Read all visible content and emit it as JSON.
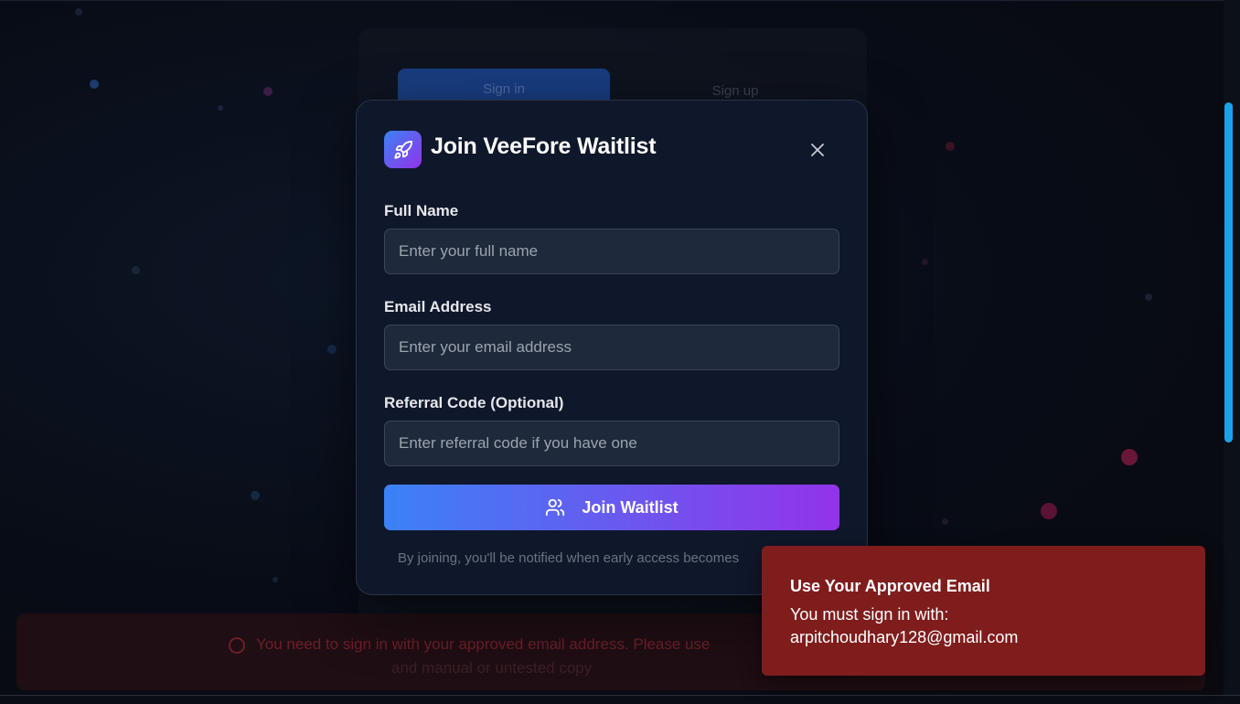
{
  "background": {
    "tab_signin": "Sign in",
    "tab_signup": "Sign up",
    "banner_line1": "You need to sign in with your approved email address. Please use",
    "banner_line2": "and manual or untested copy"
  },
  "modal": {
    "title": "Join VeeFore Waitlist",
    "logo_icon": "rocket-icon",
    "close_icon": "close-icon",
    "fields": {
      "full_name": {
        "label": "Full Name",
        "placeholder": "Enter your full name",
        "value": ""
      },
      "email": {
        "label": "Email Address",
        "placeholder": "Enter your email address",
        "value": ""
      },
      "referral": {
        "label": "Referral Code (Optional)",
        "placeholder": "Enter referral code if you have one",
        "value": ""
      }
    },
    "submit_label": "Join Waitlist",
    "submit_icon": "users-icon",
    "footnote": "By joining, you'll be notified when early access becomes"
  },
  "toast": {
    "title": "Use Your Approved Email",
    "line1": "You must sign in with:",
    "line2": "arpitchoudhary128@gmail.com"
  },
  "colors": {
    "accent_start": "#3b82f6",
    "accent_end": "#9333ea",
    "toast_bg": "#7f1d1d",
    "modal_bg": "#0f172a",
    "scrollbar": "#1aa3e8"
  }
}
